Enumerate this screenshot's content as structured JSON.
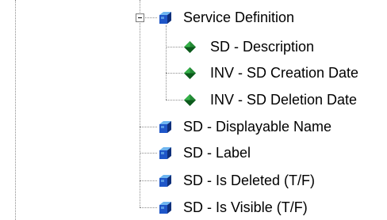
{
  "tree": {
    "parent": {
      "label": "Service Definition",
      "icon": "cube-icon",
      "expanded": true,
      "children": [
        {
          "label": "SD - Description",
          "icon": "green-diamond-icon"
        },
        {
          "label": "INV - SD Creation Date",
          "icon": "green-diamond-icon"
        },
        {
          "label": "INV - SD Deletion Date",
          "icon": "green-diamond-icon"
        }
      ]
    },
    "siblings": [
      {
        "label": "SD - Displayable Name",
        "icon": "cube-icon"
      },
      {
        "label": "SD - Label",
        "icon": "cube-icon"
      },
      {
        "label": "SD - Is Deleted (T/F)",
        "icon": "cube-icon"
      },
      {
        "label": "SD - Is Visible (T/F)",
        "icon": "cube-icon"
      }
    ]
  },
  "colors": {
    "cube_front": "#1f56c8",
    "cube_top": "#6fb6f0",
    "cube_side": "#0f2f7a",
    "diamond_light": "#36b24a",
    "diamond_dark": "#0c5a1c",
    "connector": "#8c8c8c"
  }
}
